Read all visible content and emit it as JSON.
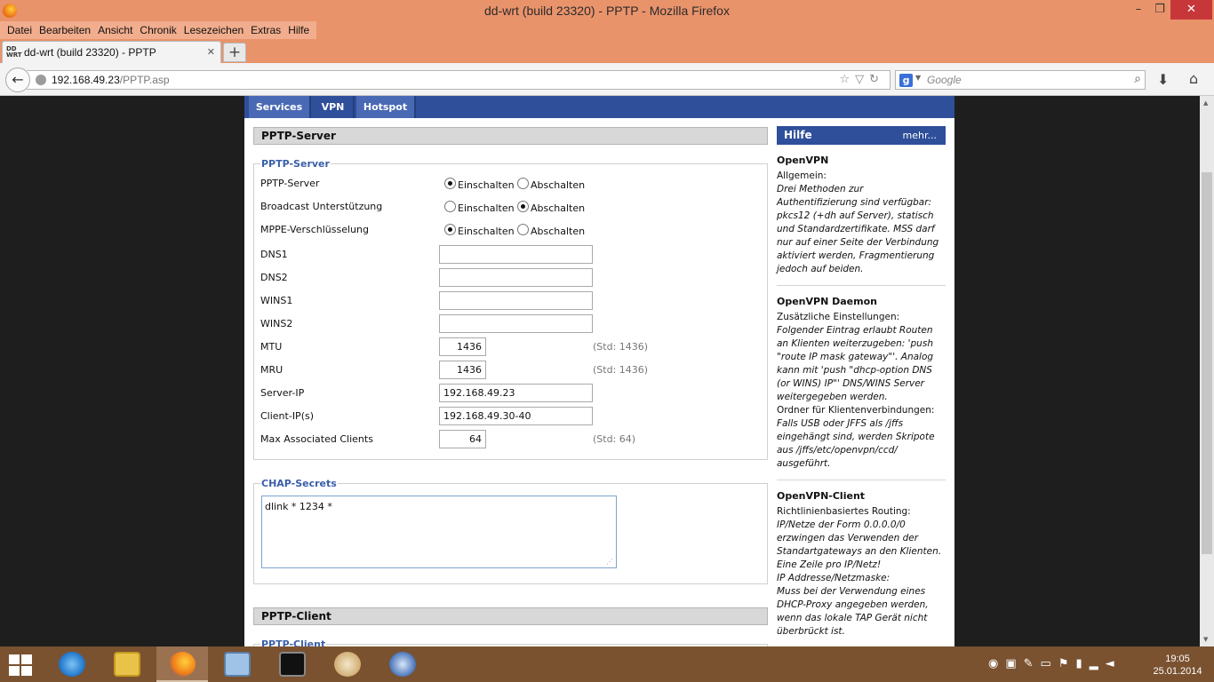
{
  "window": {
    "title": "dd-wrt (build 23320) - PPTP - Mozilla Firefox",
    "min": "–",
    "max": "❐",
    "close": "✕"
  },
  "menubar": [
    "Datei",
    "Bearbeiten",
    "Ansicht",
    "Chronik",
    "Lesezeichen",
    "Extras",
    "Hilfe"
  ],
  "tab": {
    "title": "dd-wrt (build 23320) - PPTP",
    "favicon_text": "DD WRT",
    "close": "✕",
    "new": "+"
  },
  "nav": {
    "url_host": "192.168.49.23",
    "url_path": "/PPTP.asp",
    "search_placeholder": "Google",
    "search_engine": "g",
    "icons": [
      "star-icon",
      "dropdown-icon",
      "reload-icon",
      "download-icon",
      "home-icon"
    ]
  },
  "subnav": [
    {
      "label": "Services",
      "active": false
    },
    {
      "label": "VPN",
      "active": true
    },
    {
      "label": "Hotspot",
      "active": false
    }
  ],
  "pptp_server": {
    "section_title": "PPTP-Server",
    "legend": "PPTP-Server",
    "on_label": "Einschalten",
    "off_label": "Abschalten",
    "radios": [
      {
        "label": "PPTP-Server",
        "value": "on"
      },
      {
        "label": "Broadcast Unterstützung",
        "value": "off"
      },
      {
        "label": "MPPE-Verschlüsselung",
        "value": "on"
      }
    ],
    "fields": [
      {
        "label": "DNS1",
        "value": "",
        "std": ""
      },
      {
        "label": "DNS2",
        "value": "",
        "std": ""
      },
      {
        "label": "WINS1",
        "value": "",
        "std": ""
      },
      {
        "label": "WINS2",
        "value": "",
        "std": ""
      },
      {
        "label": "MTU",
        "value": "1436",
        "std": "(Std: 1436)"
      },
      {
        "label": "MRU",
        "value": "1436",
        "std": "(Std: 1436)"
      },
      {
        "label": "Server-IP",
        "value": "192.168.49.23",
        "std": ""
      },
      {
        "label": "Client-IP(s)",
        "value": "192.168.49.30-40",
        "std": ""
      },
      {
        "label": "Max Associated Clients",
        "value": "64",
        "std": "(Std: 64)"
      }
    ]
  },
  "chap": {
    "legend": "CHAP-Secrets",
    "value": "dlink * 1234 *"
  },
  "pptp_client": {
    "section_title": "PPTP-Client",
    "legend": "PPTP-Client"
  },
  "help": {
    "title": "Hilfe",
    "more": "mehr...",
    "blocks": [
      {
        "heading": "OpenVPN",
        "paragraphs": [
          {
            "text": "Allgemein:",
            "italic": false
          },
          {
            "text": "Drei Methoden zur Authentifizierung sind verfügbar: pkcs12 (+dh auf Server), statisch und Standardzertifikate. MSS darf nur auf einer Seite der Verbindung aktiviert werden, Fragmentierung jedoch auf beiden.",
            "italic": true
          }
        ]
      },
      {
        "heading": "OpenVPN Daemon",
        "paragraphs": [
          {
            "text": "Zusätzliche Einstellungen:",
            "italic": false
          },
          {
            "text": "Folgender Eintrag erlaubt Routen an Klienten weiterzugeben: 'push \"route IP mask gateway\"'. Analog kann mit 'push \"dhcp-option DNS (or WINS) IP\"' DNS/WINS Server weitergegeben werden.",
            "italic": true
          },
          {
            "text": "Ordner für Klientenverbindungen:",
            "italic": false
          },
          {
            "text": "Falls USB oder JFFS als /jffs eingehängt sind, werden Skripote aus /jffs/etc/openvpn/ccd/ ausgeführt.",
            "italic": true
          }
        ]
      },
      {
        "heading": "OpenVPN-Client",
        "paragraphs": [
          {
            "text": "Richtlinienbasiertes Routing:",
            "italic": false
          },
          {
            "text": "IP/Netze der Form 0.0.0.0/0 erzwingen das Verwenden der Standartgateways an den Klienten. Eine Zeile pro IP/Netz!",
            "italic": true
          },
          {
            "text": "IP Addresse/Netzmaske:",
            "italic": true
          },
          {
            "text": "Muss bei der Verwendung eines DHCP-Proxy angegeben werden, wenn das lokale TAP Gerät nicht überbrückt ist.",
            "italic": true
          }
        ]
      }
    ]
  },
  "taskbar": {
    "items": [
      "internet-explorer",
      "file-explorer",
      "firefox",
      "control-panel",
      "command-prompt",
      "paint",
      "thunderbird"
    ],
    "active": "firefox",
    "clock_time": "19:05",
    "clock_date": "25.01.2014"
  },
  "colors": {
    "titlebar": "#e9936b",
    "ddwrt_blue": "#2f4f9a",
    "legend_blue": "#3a5fa8",
    "taskbar": "#7a5230"
  }
}
